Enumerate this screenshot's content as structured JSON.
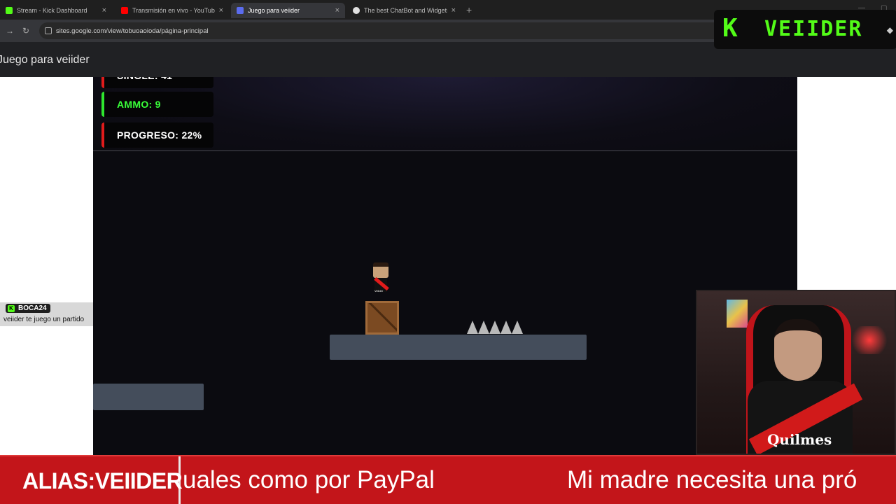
{
  "browser": {
    "tabs": [
      {
        "title": "Stream - Kick Dashboard",
        "favicon_color": "#53fc18"
      },
      {
        "title": "Transmisión en vivo - YouTube",
        "favicon_color": "#ff0000"
      },
      {
        "title": "Juego para veiider",
        "favicon_color": "#5b6cf0"
      },
      {
        "title": "The best ChatBot and Widgets",
        "favicon_color": "#e0e0e0"
      }
    ],
    "active_tab": 2,
    "url": "sites.google.com/view/tobuoaoioda/página-principal"
  },
  "page": {
    "title": "Juego para veiider"
  },
  "logo": {
    "letter": "K",
    "name": "VEIIDER",
    "color": "#53fc18"
  },
  "game": {
    "hud": {
      "top_partial": "SINGLE: 41",
      "ammo": "AMMO: 9",
      "progress": "PROGRESO: 22%"
    },
    "player_tag": "Veiider"
  },
  "chat": {
    "username": "BOCA24",
    "message": "veiider te juego un partido"
  },
  "webcam": {
    "shirt_sponsor": "Quilmes"
  },
  "ticker": {
    "alias": "ALIAS:VEIIDER",
    "text1": "uales como por PayPal",
    "text2": "Mi madre necesita una pró"
  },
  "colors": {
    "kick_green": "#53fc18",
    "ticker_red": "#c3151a",
    "hud_red": "#e01b1b",
    "hud_green": "#39ff39"
  }
}
